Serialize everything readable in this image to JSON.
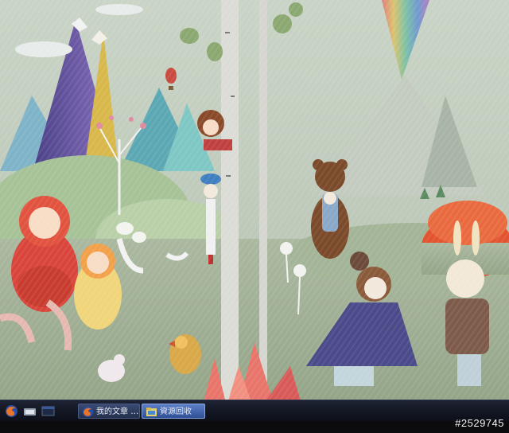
{
  "taskbar": {
    "quick_launch": [
      {
        "icon": "firefox-icon"
      },
      {
        "icon": "show-desktop-icon"
      },
      {
        "icon": "window-icon"
      }
    ],
    "tasks": [
      {
        "label": "我的文章 - Mo...",
        "icon": "firefox-icon",
        "active": false
      },
      {
        "label": "資源回收",
        "icon": "folder-window-icon",
        "active": true
      }
    ]
  },
  "watermark": "#2529745",
  "colors": {
    "wall_bg": "#bcc8ba",
    "taskbar": "#141a28",
    "active_task": "#3f62ad"
  }
}
